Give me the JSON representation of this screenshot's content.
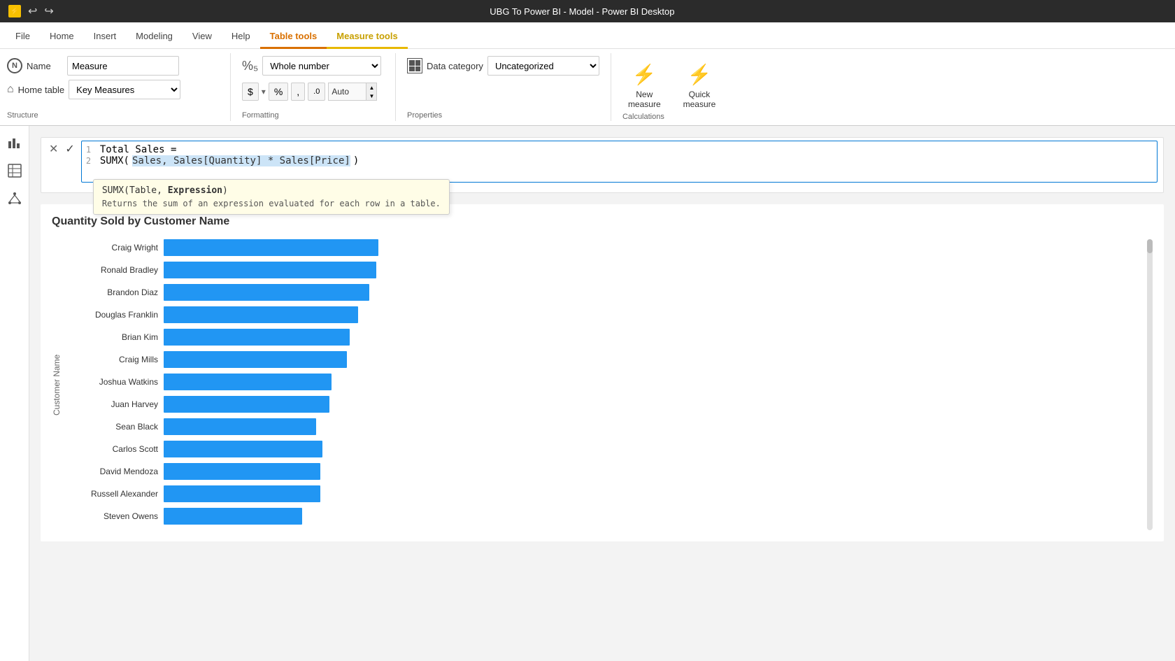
{
  "titleBar": {
    "title": "UBG To Power BI - Model - Power BI Desktop"
  },
  "ribbonTabs": {
    "tabs": [
      {
        "id": "file",
        "label": "File"
      },
      {
        "id": "home",
        "label": "Home"
      },
      {
        "id": "insert",
        "label": "Insert"
      },
      {
        "id": "modeling",
        "label": "Modeling"
      },
      {
        "id": "view",
        "label": "View"
      },
      {
        "id": "help",
        "label": "Help"
      },
      {
        "id": "tabletools",
        "label": "Table tools"
      },
      {
        "id": "measuretools",
        "label": "Measure tools",
        "active": true
      }
    ]
  },
  "structure": {
    "name_label": "Name",
    "name_value": "Measure",
    "home_table_label": "Home table",
    "home_table_value": "Key Measures",
    "format_label": "Whole number",
    "data_category_label": "Data category",
    "data_category_value": "Uncategorized",
    "dollar_btn": "$",
    "percent_btn": "%",
    "comma_btn": ",",
    "decimal_btn": ".0",
    "auto_label": "Auto",
    "section_structure": "Structure",
    "section_formatting": "Formatting",
    "section_properties": "Properties",
    "section_calculations": "Calculations"
  },
  "calculations": {
    "new_measure_label": "New\nmeasure",
    "quick_measure_label": "Quick\nmeasure"
  },
  "formulaBar": {
    "line1": "Total Sales =",
    "line2_prefix": "SUMX(",
    "line2_highlighted": "Sales, Sales[Quantity] * Sales[Price]",
    "line2_suffix": ")",
    "tooltip_signature": "SUMX(Table, ",
    "tooltip_bold": "Expression",
    "tooltip_signature_end": ")",
    "tooltip_desc": "Returns the sum of an expression evaluated for each row in a table."
  },
  "chart": {
    "title": "Quantity Sold by Customer Name",
    "y_axis_label": "Customer Name",
    "bars": [
      {
        "label": "Craig Wright",
        "pct": 96
      },
      {
        "label": "Ronald Bradley",
        "pct": 95
      },
      {
        "label": "Brandon Diaz",
        "pct": 92
      },
      {
        "label": "Douglas Franklin",
        "pct": 87
      },
      {
        "label": "Brian Kim",
        "pct": 83
      },
      {
        "label": "Craig Mills",
        "pct": 82
      },
      {
        "label": "Joshua Watkins",
        "pct": 75
      },
      {
        "label": "Juan Harvey",
        "pct": 74
      },
      {
        "label": "Sean Black",
        "pct": 68
      },
      {
        "label": "Carlos Scott",
        "pct": 71
      },
      {
        "label": "David Mendoza",
        "pct": 70
      },
      {
        "label": "Russell Alexander",
        "pct": 70
      },
      {
        "label": "Steven Owens",
        "pct": 62
      }
    ]
  },
  "sidebar": {
    "icons": [
      {
        "id": "bar-chart",
        "symbol": "▦",
        "active": false
      },
      {
        "id": "table",
        "symbol": "⊞",
        "active": false
      },
      {
        "id": "model",
        "symbol": "⬡",
        "active": false
      }
    ]
  }
}
